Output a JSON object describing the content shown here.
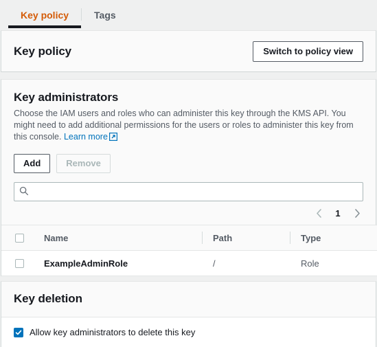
{
  "tabs": [
    {
      "label": "Key policy",
      "active": true
    },
    {
      "label": "Tags",
      "active": false
    }
  ],
  "policy_header": {
    "title": "Key policy",
    "switch_button": "Switch to policy view"
  },
  "key_administrators": {
    "title": "Key administrators",
    "description_part1": "Choose the IAM users and roles who can administer this key through the KMS API. You might need to add additional permissions for the users or roles to administer this key from this console.",
    "learn_more": "Learn more",
    "add_button": "Add",
    "remove_button": "Remove",
    "search_placeholder": "",
    "search_value": "",
    "pagination": {
      "prev": "‹",
      "page": "1",
      "next": "›"
    },
    "table": {
      "columns": [
        "Name",
        "Path",
        "Type"
      ],
      "rows": [
        {
          "name": "ExampleAdminRole",
          "path": "/",
          "type": "Role",
          "selected": false
        }
      ]
    }
  },
  "key_deletion": {
    "title": "Key deletion",
    "allow_label": "Allow key administrators to delete this key",
    "allow_checked": true
  },
  "colors": {
    "accent_orange": "#d45b07",
    "link_blue": "#0073bb",
    "checkbox_blue": "#0073bb",
    "page_background": "#eff0f0",
    "panel_background": "#fafafa"
  }
}
